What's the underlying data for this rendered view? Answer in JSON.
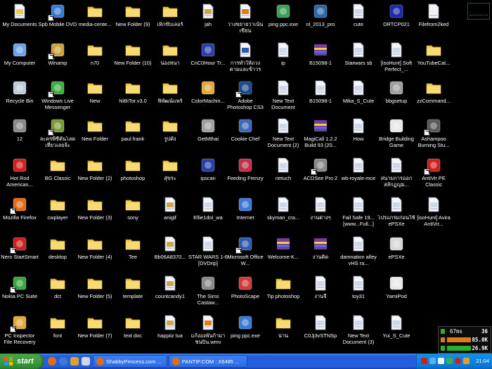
{
  "desktop_icons": [
    {
      "label": "My Documents",
      "icon": "my-documents-icon",
      "color": "#f1c84b",
      "shortcut": false
    },
    {
      "label": "My Computer",
      "icon": "my-computer-icon",
      "color": "#6ea4e6",
      "shortcut": false
    },
    {
      "label": "Recycle Bin",
      "icon": "recycle-bin-icon",
      "color": "#bfcbd8",
      "shortcut": false
    },
    {
      "label": "12",
      "icon": "people-icon",
      "color": "#8a8a8a",
      "shortcut": false
    },
    {
      "label": "Hot Rod American...",
      "icon": "hot-rod-icon",
      "color": "#d21e1e",
      "shortcut": false
    },
    {
      "label": "Mozilla Firefox",
      "icon": "firefox-icon",
      "color": "#e36b14",
      "shortcut": true
    },
    {
      "label": "Nero StartSmart",
      "icon": "nero-icon",
      "color": "#cc1f1f",
      "shortcut": true
    },
    {
      "label": "Nokia PC Suite",
      "icon": "nokia-pc-suite-icon",
      "color": "#3aa73a",
      "shortcut": true
    },
    {
      "label": "PC Inspector File Recovery",
      "icon": "pc-inspector-icon",
      "color": "#e2a83a",
      "shortcut": true
    },
    {
      "label": "Spb Mobile DVD",
      "icon": "film-icon",
      "color": "#3a7bd5",
      "shortcut": true
    },
    {
      "label": "Winamp",
      "icon": "winamp-icon",
      "color": "#c8a43a",
      "shortcut": true
    },
    {
      "label": "Windows Live Messenger",
      "icon": "messenger-icon",
      "color": "#3cb043",
      "shortcut": true
    },
    {
      "label": "ละครพีซีตันโลด เที่ยวเลยจ้ะ",
      "icon": "game-shortcut-icon",
      "color": "#7a9a3a",
      "shortcut": true
    },
    {
      "label": "BG Classic",
      "icon": "folder-icon",
      "color": "#f3cc4f",
      "shortcut": false
    },
    {
      "label": "cwplayer",
      "icon": "folder-icon",
      "color": "#f3cc4f",
      "shortcut": false
    },
    {
      "label": "desktop",
      "icon": "folder-icon",
      "color": "#f3cc4f",
      "shortcut": false
    },
    {
      "label": "dct",
      "icon": "folder-icon",
      "color": "#f3cc4f",
      "shortcut": false
    },
    {
      "label": "font",
      "icon": "folder-icon",
      "color": "#f3cc4f",
      "shortcut": false
    },
    {
      "label": "media-cente...",
      "icon": "folder-icon",
      "color": "#f3cc4f",
      "shortcut": false
    },
    {
      "label": "n70",
      "icon": "folder-icon",
      "color": "#f3cc4f",
      "shortcut": false
    },
    {
      "label": "New",
      "icon": "folder-icon",
      "color": "#f3cc4f",
      "shortcut": false
    },
    {
      "label": "New Folder",
      "icon": "folder-icon",
      "color": "#f3cc4f",
      "shortcut": false
    },
    {
      "label": "New Folder (2)",
      "icon": "folder-icon",
      "color": "#f3cc4f",
      "shortcut": false
    },
    {
      "label": "New Folder (3)",
      "icon": "folder-icon",
      "color": "#f3cc4f",
      "shortcut": false
    },
    {
      "label": "New Folder (4)",
      "icon": "folder-icon",
      "color": "#f3cc4f",
      "shortcut": false
    },
    {
      "label": "New Folder (5)",
      "icon": "folder-icon",
      "color": "#f3cc4f",
      "shortcut": false
    },
    {
      "label": "New Folder (7)",
      "icon": "folder-icon",
      "color": "#f3cc4f",
      "shortcut": false
    },
    {
      "label": "New Folder (9)",
      "icon": "folder-icon",
      "color": "#f3cc4f",
      "shortcut": false
    },
    {
      "label": "New Folder (10)",
      "icon": "folder-icon",
      "color": "#f3cc4f",
      "shortcut": false
    },
    {
      "label": "NiBiTor.v3.0",
      "icon": "folder-icon",
      "color": "#f3cc4f",
      "shortcut": false
    },
    {
      "label": "paul frank",
      "icon": "folder-icon",
      "color": "#f3cc4f",
      "shortcut": false
    },
    {
      "label": "photoshop",
      "icon": "folder-icon",
      "color": "#f3cc4f",
      "shortcut": false
    },
    {
      "label": "sony",
      "icon": "folder-icon",
      "color": "#f3cc4f",
      "shortcut": false
    },
    {
      "label": "Tee",
      "icon": "folder-icon",
      "color": "#f3cc4f",
      "shortcut": false
    },
    {
      "label": "template",
      "icon": "folder-icon",
      "color": "#f3cc4f",
      "shortcut": false
    },
    {
      "label": "text doc",
      "icon": "folder-icon",
      "color": "#f3cc4f",
      "shortcut": false
    },
    {
      "label": "เห็กขับเลอร์",
      "icon": "folder-icon",
      "color": "#f3cc4f",
      "shortcut": false
    },
    {
      "label": "น่องหนา",
      "icon": "folder-icon",
      "color": "#f3cc4f",
      "shortcut": false
    },
    {
      "label": "พิพัฒน์แพร์",
      "icon": "folder-icon",
      "color": "#f3cc4f",
      "shortcut": false
    },
    {
      "label": "รูปตั้ง",
      "icon": "folder-icon",
      "color": "#f3cc4f",
      "shortcut": false
    },
    {
      "label": "สุ่ขระ",
      "icon": "folder-icon",
      "color": "#f3cc4f",
      "shortcut": false
    },
    {
      "label": "anigif",
      "icon": "image-file-icon",
      "color": "#c8a84a",
      "shortcut": false
    },
    {
      "label": "Bb06A8370...",
      "icon": "image-file-icon",
      "color": "#c8a84a",
      "shortcut": false
    },
    {
      "label": "countcandy1",
      "icon": "image-file-icon",
      "color": "#c8a84a",
      "shortcut": false
    },
    {
      "label": "happiiz tua",
      "icon": "image-file-icon",
      "color": "#c8a84a",
      "shortcut": false
    },
    {
      "label": "jah",
      "icon": "image-file-icon",
      "color": "#c8a84a",
      "shortcut": false
    },
    {
      "label": "CnC0Hour Tr...",
      "icon": "cnc-icon",
      "color": "#2a3ea8",
      "shortcut": false
    },
    {
      "label": "ColorMachin...",
      "icon": "colormachine-icon",
      "color": "#e2a83a",
      "shortcut": false
    },
    {
      "label": "GetMthai",
      "icon": "getmthai-icon",
      "color": "#a0a0a0",
      "shortcut": false
    },
    {
      "label": "ipscan",
      "icon": "ipscan-icon",
      "color": "#2a3ea8",
      "shortcut": false
    },
    {
      "label": "Ellie1dol_wa",
      "icon": "document-icon",
      "color": "#d0d8e8",
      "shortcut": false
    },
    {
      "label": "STAR WARS 1-6 [DVDrip]",
      "icon": "document-icon",
      "color": "#d0d8e8",
      "shortcut": false
    },
    {
      "label": "The Sims Castaw...",
      "icon": "sims-icon",
      "color": "#8a8a8a",
      "shortcut": false
    },
    {
      "label": "แก้งองพันก้ามาชนบิน.wmv",
      "icon": "video-file-icon",
      "color": "#e07a1a",
      "shortcut": false
    },
    {
      "label": "วางขยายวาเน้นเขียน",
      "icon": "video-file-icon",
      "color": "#e07a1a",
      "shortcut": false
    },
    {
      "label": "การทำให้ถวงตามและข้าวร",
      "icon": "word-doc-icon",
      "color": "#2f5ab2",
      "shortcut": false
    },
    {
      "label": "Adobe Photoshop CS3",
      "icon": "photoshop-icon",
      "color": "#1b4a8a",
      "shortcut": true
    },
    {
      "label": "Cookie Chef",
      "icon": "cookie-chef-icon",
      "color": "#3a6ab8",
      "shortcut": false
    },
    {
      "label": "Feeding Frenzy",
      "icon": "feeding-frenzy-icon",
      "color": "#c0304a",
      "shortcut": false
    },
    {
      "label": "Internet",
      "icon": "internet-explorer-icon",
      "color": "#3b7bd6",
      "shortcut": false
    },
    {
      "label": "Microsoft Office W...",
      "icon": "word-icon",
      "color": "#2f5ab2",
      "shortcut": true
    },
    {
      "label": "PhotoScape",
      "icon": "photoscape-icon",
      "color": "#d03a3a",
      "shortcut": false
    },
    {
      "label": "ping ppc.exe",
      "icon": "app-exe-icon",
      "color": "#3b7bd6",
      "shortcut": false
    },
    {
      "label": "ping ppc.exe",
      "icon": "globe-icon",
      "color": "#3aa05a",
      "shortcut": false
    },
    {
      "label": "ip",
      "icon": "document-icon",
      "color": "#d0d8e8",
      "shortcut": false
    },
    {
      "label": "New Text Document",
      "icon": "text-doc-icon",
      "color": "#d0d8e8",
      "shortcut": false
    },
    {
      "label": "New Text Document (2)",
      "icon": "text-doc-icon",
      "color": "#d0d8e8",
      "shortcut": false
    },
    {
      "label": "netuch",
      "icon": "text-doc-icon",
      "color": "#d0d8e8",
      "shortcut": false
    },
    {
      "label": "skyman_cra...",
      "icon": "document-icon",
      "color": "#d0d8e8",
      "shortcut": false
    },
    {
      "label": "Welcome-K...",
      "icon": "rar-archive-icon",
      "color": "#7a3aa8",
      "shortcut": false
    },
    {
      "label": "Tip photoshop",
      "icon": "folder-icon",
      "color": "#f3cc4f",
      "shortcut": false
    },
    {
      "label": "น่าน",
      "icon": "folder-icon",
      "color": "#f3cc4f",
      "shortcut": false
    },
    {
      "label": "nl_2013_pro",
      "icon": "nl-app-icon",
      "color": "#2a6aa8",
      "shortcut": false
    },
    {
      "label": "B15098-1",
      "icon": "rar-archive-icon",
      "color": "#7a3aa8",
      "shortcut": false
    },
    {
      "label": "B15098-1",
      "icon": "document-icon",
      "color": "#d0d8e8",
      "shortcut": false
    },
    {
      "label": "MagiCall 1.2.2 Build 93 (20...",
      "icon": "rar-archive-icon",
      "color": "#7a3aa8",
      "shortcut": false
    },
    {
      "label": "ACDSee Pro 2",
      "icon": "acdsee-icon",
      "color": "#8a8a8a",
      "shortcut": true
    },
    {
      "label": "งานต่างๆ",
      "icon": "document-icon",
      "color": "#d0d8e8",
      "shortcut": false
    },
    {
      "label": "งานคิด",
      "icon": "rar-archive-icon",
      "color": "#7a3aa8",
      "shortcut": false
    },
    {
      "label": "งานจี",
      "icon": "document-icon",
      "color": "#d0d8e8",
      "shortcut": false
    },
    {
      "label": "C0Jj3vSTNSp",
      "icon": "document-icon",
      "color": "#d0d8e8",
      "shortcut": false
    },
    {
      "label": "cute",
      "icon": "document-icon",
      "color": "#d0d8e8",
      "shortcut": false
    },
    {
      "label": "Starwars sb",
      "icon": "document-icon",
      "color": "#d0d8e8",
      "shortcut": false
    },
    {
      "label": "Mika_S_Cute",
      "icon": "document-icon",
      "color": "#d0d8e8",
      "shortcut": false
    },
    {
      "label": "How",
      "icon": "document-icon",
      "color": "#d0d8e8",
      "shortcut": false
    },
    {
      "label": "wb-royale-mce",
      "icon": "document-icon",
      "color": "#d0d8e8",
      "shortcut": false
    },
    {
      "label": "Fail Safe 19...[www...Full...]",
      "icon": "document-icon",
      "color": "#d0d8e8",
      "shortcut": false
    },
    {
      "label": "damnation alley vHS ra...",
      "icon": "document-icon",
      "color": "#d0d8e8",
      "shortcut": false
    },
    {
      "label": "toy31",
      "icon": "document-icon",
      "color": "#d0d8e8",
      "shortcut": false
    },
    {
      "label": "New Text Document (3)",
      "icon": "text-doc-icon",
      "color": "#d0d8e8",
      "shortcut": false
    },
    {
      "label": "DRTCP021",
      "icon": "drtcp-icon",
      "color": "#1a2aa8",
      "shortcut": false
    },
    {
      "label": "[isoHunt] Soft Perfect_...",
      "icon": "document-icon",
      "color": "#d0d8e8",
      "shortcut": false
    },
    {
      "label": "bbgsetup",
      "icon": "setup-icon",
      "color": "#a0a0a0",
      "shortcut": false
    },
    {
      "label": "Bridge Building Game",
      "icon": "bridge-game-icon",
      "color": "#e8e8e8",
      "shortcut": false
    },
    {
      "label": "สนามการออก สลักฏูญม...",
      "icon": "document-icon",
      "color": "#d0d8e8",
      "shortcut": false
    },
    {
      "label": "โปรแกรมก่อนใช้ ePSXe",
      "icon": "document-icon",
      "color": "#d0d8e8",
      "shortcut": false
    },
    {
      "label": "ePSXe",
      "icon": "gamepad-icon",
      "color": "#d8d8d8",
      "shortcut": false
    },
    {
      "label": "YamiPod",
      "icon": "ipod-icon",
      "color": "#e8e8e8",
      "shortcut": false
    },
    {
      "label": "Yui_S_Cute",
      "icon": "document-icon",
      "color": "#d0d8e8",
      "shortcut": false
    },
    {
      "label": "Filefrom2ked",
      "icon": "text-doc-icon",
      "color": "#f0f0f0",
      "shortcut": false
    },
    {
      "label": "YouTubeCat...",
      "icon": "folder-icon",
      "color": "#f3cc4f",
      "shortcut": false
    },
    {
      "label": "zzCommand...",
      "icon": "folder-icon",
      "color": "#f3cc4f",
      "shortcut": false
    },
    {
      "label": "Ashampoo Burning Stu...",
      "icon": "ashampoo-icon",
      "color": "#5a5a5a",
      "shortcut": true
    },
    {
      "label": "AntiVir PE Classic",
      "icon": "antivir-icon",
      "color": "#d01e1e",
      "shortcut": true
    },
    {
      "label": "[isoHunt] Avira AntiVir...",
      "icon": "document-icon",
      "color": "#d0d8e8",
      "shortcut": false
    }
  ],
  "meter": {
    "ping": "67ms",
    "ping_extra": "36",
    "down": "85.0K",
    "up": "26.9K"
  },
  "taskbar": {
    "start_label": "start",
    "tasks": [
      {
        "label": "ShabbyPrincess.com ...",
        "active": false
      },
      {
        "label": "PANTIP.COM : X6485 ...",
        "active": false
      }
    ],
    "clock": "21:04"
  }
}
